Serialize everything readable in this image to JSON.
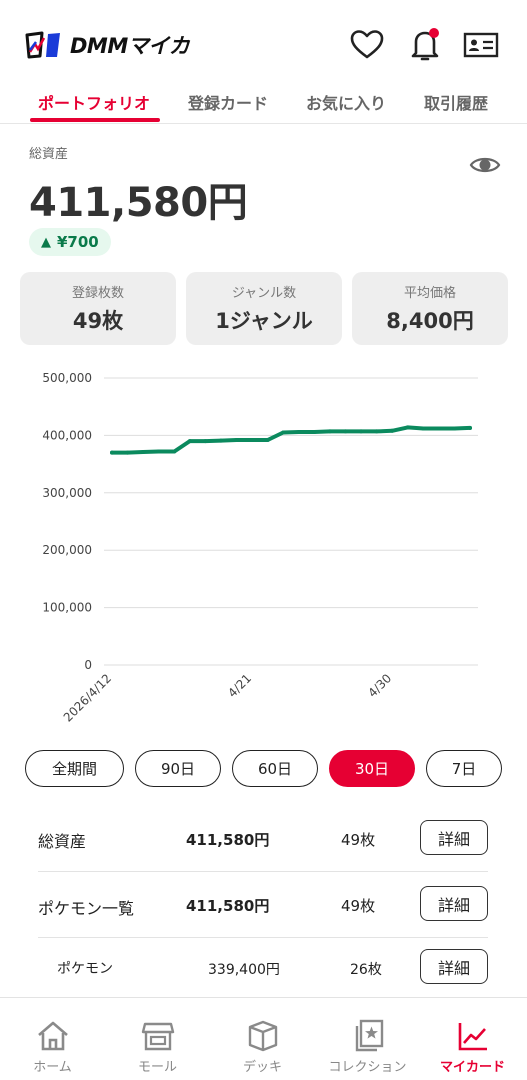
{
  "app": {
    "logo_text": "DMMマイカ"
  },
  "tabs": [
    {
      "label": "ポートフォリオ",
      "active": true
    },
    {
      "label": "登録カード"
    },
    {
      "label": "お気に入り"
    },
    {
      "label": "取引履歴"
    }
  ],
  "assets": {
    "label": "総資産",
    "value": "411,580円",
    "delta_arrow": "▲",
    "delta": "¥700"
  },
  "stats": [
    {
      "label": "登録枚数",
      "value": "49枚"
    },
    {
      "label": "ジャンル数",
      "value": "1ジャンル"
    },
    {
      "label": "平均価格",
      "value": "8,400円"
    }
  ],
  "chart_data": {
    "type": "line",
    "x": [
      "2026/4/12",
      "2026/4/13",
      "2026/4/14",
      "2026/4/15",
      "2026/4/16",
      "2026/4/17",
      "2026/4/18",
      "2026/4/19",
      "2026/4/20",
      "2026/4/21",
      "2026/4/22",
      "2026/4/23",
      "2026/4/24",
      "2026/4/25",
      "2026/4/26",
      "2026/4/27",
      "2026/4/28",
      "2026/4/29",
      "2026/4/30",
      "2026/5/1",
      "2026/5/2",
      "2026/5/3",
      "2026/5/4",
      "2026/5/5"
    ],
    "series": [
      {
        "values": [
          370000,
          370000,
          371000,
          372000,
          372000,
          390000,
          390000,
          391000,
          392000,
          392000,
          392000,
          405000,
          406000,
          406000,
          407000,
          407000,
          407000,
          407000,
          408000,
          414000,
          412000,
          412000,
          412000,
          413000
        ],
        "color": "#0b8a5e"
      }
    ],
    "x_tick_labels": [
      {
        "text": "2026/4/12",
        "index": 0
      },
      {
        "text": "4/21",
        "index": 9
      },
      {
        "text": "4/30",
        "index": 18
      }
    ],
    "y_ticks": [
      "500,000",
      "400,000",
      "300,000",
      "200,000",
      "100,000",
      "0"
    ],
    "ylim": [
      0,
      500000
    ],
    "grid": true
  },
  "periods": [
    {
      "label": "全期間"
    },
    {
      "label": "90日"
    },
    {
      "label": "60日"
    },
    {
      "label": "30日",
      "active": true
    },
    {
      "label": "7日"
    }
  ],
  "table": {
    "rows": [
      {
        "name": "総資産",
        "amount": "411,580円",
        "count": "49枚",
        "button": "詳細"
      },
      {
        "name": "ポケモン一覧",
        "amount": "411,580円",
        "count": "49枚",
        "button": "詳細"
      },
      {
        "name": "ポケモン",
        "amount": "339,400円",
        "count": "26枚",
        "button": "詳細"
      }
    ]
  },
  "bottom_nav": [
    {
      "label": "ホーム",
      "icon": "home-icon"
    },
    {
      "label": "モール",
      "icon": "shop-icon"
    },
    {
      "label": "デッキ",
      "icon": "deck-box-icon"
    },
    {
      "label": "コレクション",
      "icon": "collection-icon"
    },
    {
      "label": "マイカード",
      "icon": "chart-icon",
      "active": true
    }
  ],
  "colors": {
    "accent": "#e60033",
    "positive": "#0b8a5e"
  }
}
